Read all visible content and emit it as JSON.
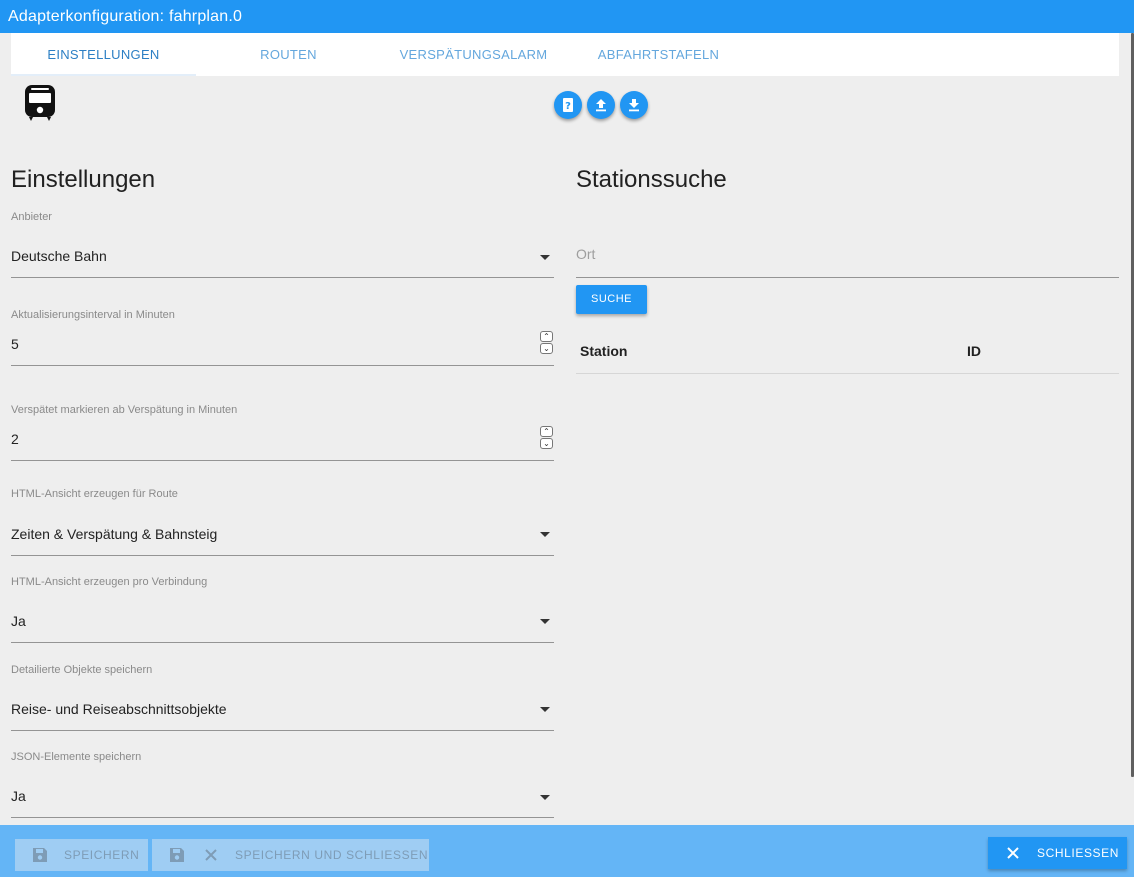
{
  "window": {
    "title": "Adapterkonfiguration: fahrplan.0"
  },
  "tabs": [
    {
      "label": "Einstellungen",
      "active": true
    },
    {
      "label": "Routen",
      "active": false
    },
    {
      "label": "Verspätungsalarm",
      "active": false
    },
    {
      "label": "Abfahrtstafeln",
      "active": false
    }
  ],
  "toolbar": {
    "icons": [
      "help-icon",
      "upload-icon",
      "download-icon"
    ]
  },
  "settings": {
    "title": "Einstellungen",
    "fields": [
      {
        "label": "Anbieter",
        "value": "Deutsche Bahn",
        "type": "select"
      },
      {
        "label": "Aktualisierungsinterval in Minuten",
        "value": "5",
        "type": "number"
      },
      {
        "label": "Verspätet markieren ab Verspätung in Minuten",
        "value": "2",
        "type": "number"
      },
      {
        "label": "HTML-Ansicht erzeugen für Route",
        "value": "Zeiten & Verspätung & Bahnsteig",
        "type": "select"
      },
      {
        "label": "HTML-Ansicht erzeugen pro Verbindung",
        "value": "Ja",
        "type": "select"
      },
      {
        "label": "Detailierte Objekte speichern",
        "value": "Reise- und Reiseabschnittsobjekte",
        "type": "select"
      },
      {
        "label": "JSON-Elemente speichern",
        "value": "Ja",
        "type": "select"
      }
    ]
  },
  "station_search": {
    "title": "Stationssuche",
    "placeholder": "Ort",
    "button_label": "Suche",
    "columns": [
      "Station",
      "ID"
    ]
  },
  "footer": {
    "save_label": "Speichern",
    "save_close_label": "Speichern und schliessen",
    "close_label": "Schliessen"
  },
  "colors": {
    "primary": "#2196f3",
    "footer": "#64b5f6",
    "background": "#eeeeee"
  }
}
